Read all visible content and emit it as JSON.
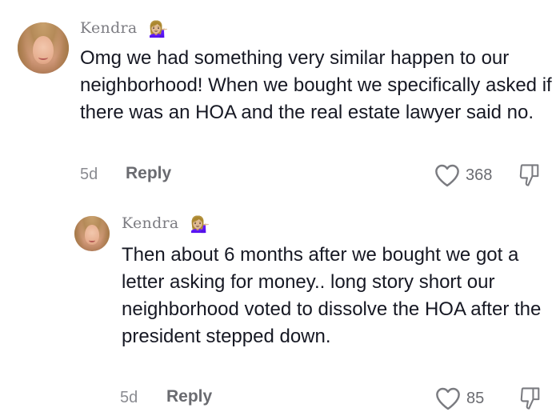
{
  "comments": [
    {
      "username": "Kendra",
      "badge_emoji": "💁🏼‍♀️",
      "badge_icon": "person-tipping-hand-emoji",
      "text": "Omg we had something very similar happen to our neighborhood! When we bought we specifically asked if there was an HOA and the real estate lawyer said no.",
      "time": "5d",
      "reply_label": "Reply",
      "likes": "368",
      "like_icon": "heart-outline-icon",
      "dislike_icon": "thumbs-down-outline-icon"
    },
    {
      "username": "Kendra",
      "badge_emoji": "💁🏼‍♀️",
      "badge_icon": "person-tipping-hand-emoji",
      "text": "Then about 6 months after we bought we got a letter asking for money.. long story short our neighborhood voted to dissolve the HOA after the president stepped down.",
      "time": "5d",
      "reply_label": "Reply",
      "likes": "85",
      "like_icon": "heart-outline-icon",
      "dislike_icon": "thumbs-down-outline-icon"
    }
  ],
  "colors": {
    "text": "#161823",
    "username": "#7c7c82",
    "meta": "#8a8b91"
  }
}
